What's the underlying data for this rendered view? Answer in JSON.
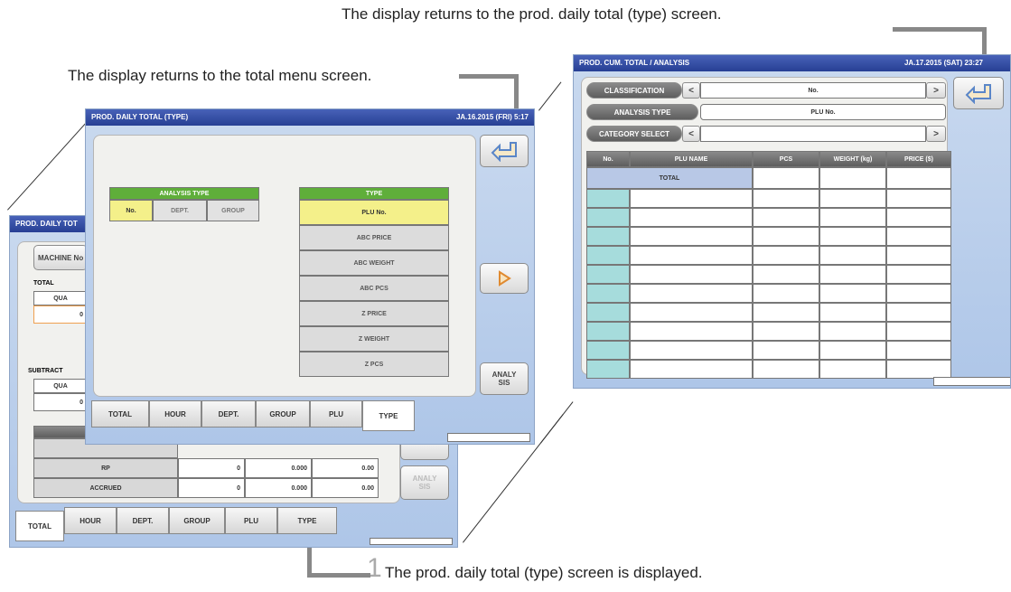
{
  "captions": {
    "top": "The display returns to the prod. daily total (type) screen.",
    "left": "The display returns to the total menu screen.",
    "bottom": "The prod. daily total (type) screen is displayed.",
    "step": "1"
  },
  "back_screen": {
    "title": "PROD. DAILY TOT",
    "machine_label": "MACHINE No",
    "total_label": "TOTAL",
    "qua_label": "QUA",
    "total_value": "0",
    "subtract_label": "SUBTRACT",
    "qua_label2": "QUA",
    "subtract_value": "0",
    "rows": [
      {
        "label": "RP",
        "pcs": "0",
        "weight": "0.000",
        "price": "0.00"
      },
      {
        "label": "ACCRUED",
        "pcs": "0",
        "weight": "0.000",
        "price": "0.00"
      }
    ],
    "analysis_button": "ANALY\nSIS",
    "tabs": [
      "TOTAL",
      "HOUR",
      "DEPT.",
      "GROUP",
      "PLU",
      "TYPE"
    ]
  },
  "middle_screen": {
    "title": "PROD. DAILY TOTAL (TYPE)",
    "date": "JA.16.2015 (FRI)  5:17",
    "analysis_type_header": "ANALYSIS TYPE",
    "analysis_options": [
      "No.",
      "DEPT.",
      "GROUP"
    ],
    "type_header": "TYPE",
    "type_options": [
      "PLU No.",
      "ABC PRICE",
      "ABC WEIGHT",
      "ABC PCS",
      "Z PRICE",
      "Z WEIGHT",
      "Z PCS"
    ],
    "analysis_button": "ANALY\nSIS",
    "tabs": [
      "TOTAL",
      "HOUR",
      "DEPT.",
      "GROUP",
      "PLU",
      "TYPE"
    ]
  },
  "right_screen": {
    "title": "PROD. CUM. TOTAL / ANALYSIS",
    "date": "JA.17.2015 (SAT)  23:27",
    "classification_label": "CLASSIFICATION",
    "classification_value": "No.",
    "analysis_type_label": "ANALYSIS TYPE",
    "analysis_type_value": "PLU No.",
    "category_label": "CATEGORY SELECT",
    "category_value": "",
    "prev": "<",
    "next": ">",
    "columns": [
      "No.",
      "PLU NAME",
      "PCS",
      "WEIGHT (kg)",
      "PRICE ($)"
    ],
    "total_row": "TOTAL"
  },
  "colors": {
    "title_bar": "#273f94",
    "selected": "#f4f08a",
    "green_header": "#5fae3a",
    "cyan_cell": "#a6dcdc"
  }
}
